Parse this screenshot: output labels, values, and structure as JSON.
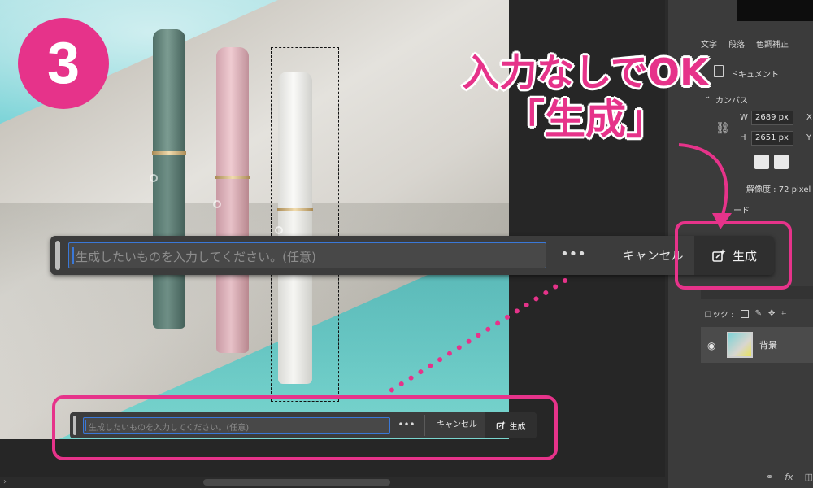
{
  "step_badge": {
    "number": "3"
  },
  "callout": {
    "line1": "入力なしでOK",
    "line2": "「生成」"
  },
  "taskbar": {
    "prompt_placeholder": "生成したいものを入力してください。(任意)",
    "more_label": "•••",
    "cancel_label": "キャンセル",
    "generate_label": "生成"
  },
  "taskbar_small": {
    "prompt_placeholder": "生成したいものを入力してください。(任意)",
    "more_label": "•••",
    "cancel_label": "キャンセル",
    "generate_label": "生成"
  },
  "right_panel": {
    "tabs": [
      "文字",
      "段落",
      "色調補正"
    ],
    "document_label": "ドキュメント",
    "canvas_label": "カンバス",
    "width_label": "W",
    "width_value": "2689 px",
    "height_label": "H",
    "height_value": "2651 px",
    "x_label": "X",
    "y_label": "Y",
    "resolution": "解像度 : 72 pixel",
    "mode_fragment": "ード",
    "lock_label": "ロック :",
    "layer_name": "背景"
  },
  "colors": {
    "accent": "#e6338a",
    "panel": "#3b3b3b",
    "focus": "#3a78d8"
  },
  "icons": [
    "generate-icon",
    "more-icon",
    "eye-icon",
    "link-icon",
    "document-icon",
    "lock-icon",
    "brush-icon",
    "move-icon",
    "fx-icon",
    "link-layers-icon"
  ]
}
